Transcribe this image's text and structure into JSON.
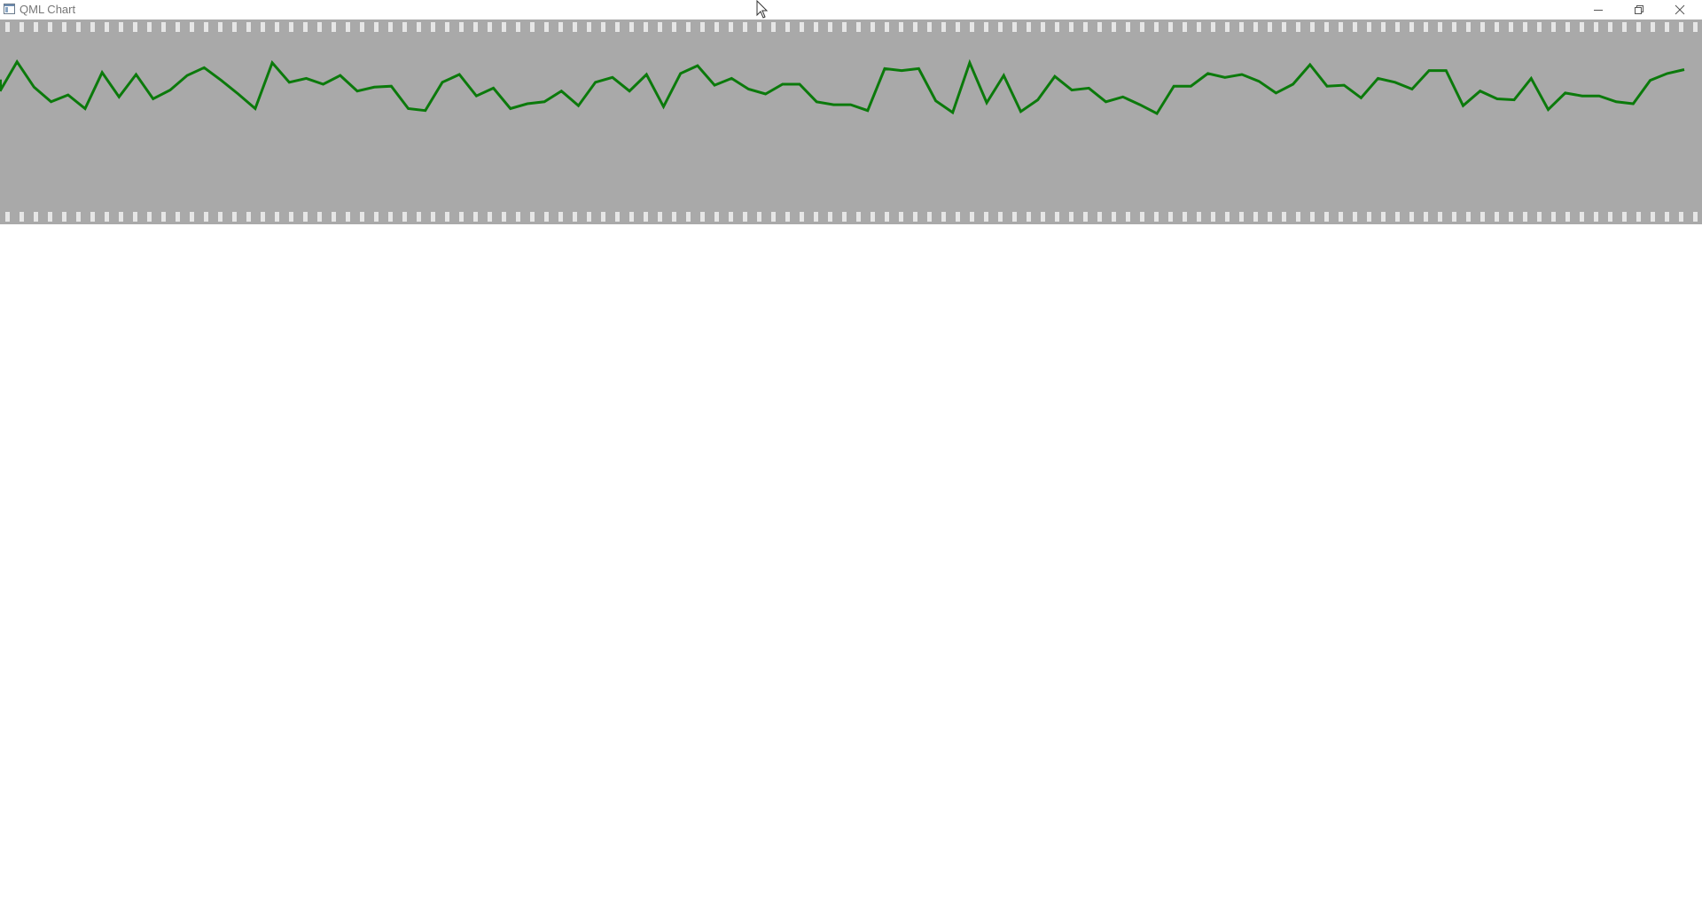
{
  "window": {
    "title": "QML Chart"
  },
  "chart_data": {
    "type": "line",
    "title": "",
    "xlabel": "",
    "ylabel": "",
    "grid": false,
    "background_color": "#a9a9a9",
    "tick_color": "#e6e6e6",
    "series": [
      {
        "color": "#0b7a0b",
        "x": [
          0,
          1,
          2,
          3,
          4,
          5,
          6,
          7,
          8,
          9,
          10,
          11,
          12,
          13,
          14,
          15,
          16,
          17,
          18,
          19,
          20,
          21,
          22,
          23,
          24,
          25,
          26,
          27,
          28,
          29,
          30,
          31,
          32,
          33,
          34,
          35,
          36,
          37,
          38,
          39,
          40,
          41,
          42,
          43,
          44,
          45,
          46,
          47,
          48,
          49,
          50,
          51,
          52,
          53,
          54,
          55,
          56,
          57,
          58,
          59,
          60,
          61,
          62,
          63,
          64,
          65,
          66,
          67,
          68,
          69,
          70,
          71,
          72,
          73,
          74,
          75,
          76,
          77,
          78,
          79,
          80,
          81,
          82,
          83,
          84,
          85,
          86,
          87,
          88,
          89,
          90,
          91,
          92,
          93,
          94,
          95,
          96,
          97,
          98,
          99
        ],
        "values": [
          0.63,
          0.93,
          0.67,
          0.52,
          0.59,
          0.45,
          0.82,
          0.57,
          0.8,
          0.55,
          0.64,
          0.79,
          0.87,
          0.74,
          0.6,
          0.45,
          0.92,
          0.72,
          0.76,
          0.7,
          0.79,
          0.63,
          0.67,
          0.68,
          0.45,
          0.43,
          0.72,
          0.8,
          0.58,
          0.66,
          0.45,
          0.5,
          0.52,
          0.63,
          0.48,
          0.72,
          0.77,
          0.63,
          0.8,
          0.47,
          0.81,
          0.89,
          0.69,
          0.76,
          0.65,
          0.6,
          0.7,
          0.7,
          0.52,
          0.49,
          0.49,
          0.43,
          0.86,
          0.84,
          0.86,
          0.53,
          0.41,
          0.92,
          0.51,
          0.79,
          0.42,
          0.54,
          0.78,
          0.64,
          0.66,
          0.52,
          0.57,
          0.49,
          0.4,
          0.68,
          0.68,
          0.81,
          0.77,
          0.8,
          0.73,
          0.61,
          0.7,
          0.9,
          0.68,
          0.69,
          0.56,
          0.76,
          0.72,
          0.65,
          0.84,
          0.84,
          0.48,
          0.63,
          0.55,
          0.54,
          0.76,
          0.44,
          0.61,
          0.58,
          0.58,
          0.52,
          0.5,
          0.74,
          0.81,
          0.85
        ]
      }
    ]
  }
}
